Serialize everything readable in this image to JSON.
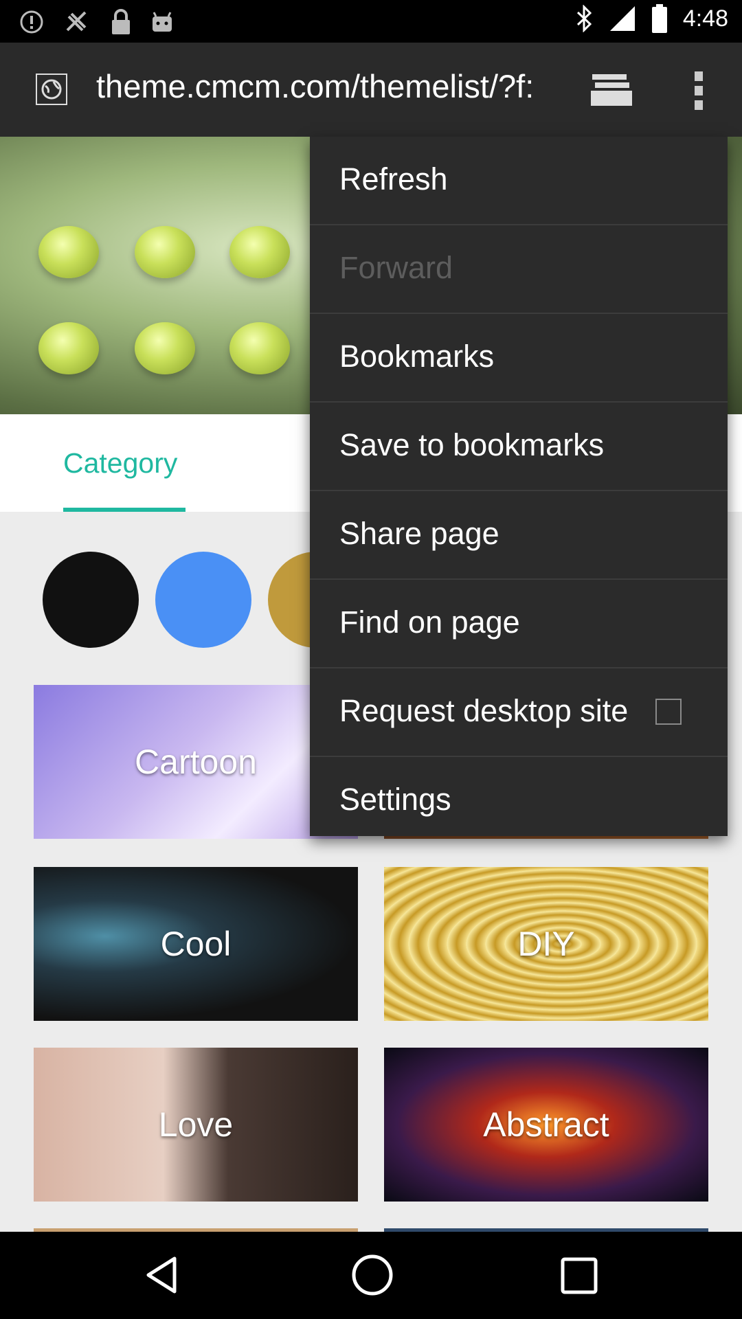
{
  "status_bar": {
    "time": "4:48",
    "icons": [
      "alert-icon",
      "fake-gps-icon",
      "lock-icon",
      "android-icon",
      "bluetooth-icon",
      "signal-icon",
      "battery-icon"
    ]
  },
  "toolbar": {
    "url": "theme.cmcm.com/themelist/?f:",
    "icons": [
      "site-icon",
      "tabs-icon",
      "more-vert-icon"
    ]
  },
  "page": {
    "tab_label": "Category",
    "accent_color": "#1fb8a0",
    "swatch_colors": [
      "#111111",
      "#4a90f5",
      "#c09a3c"
    ],
    "cards": [
      {
        "label": "Cartoon"
      },
      {
        "label": ""
      },
      {
        "label": "Cool"
      },
      {
        "label": "DIY"
      },
      {
        "label": "Love"
      },
      {
        "label": "Abstract"
      }
    ]
  },
  "menu": {
    "items": [
      {
        "label": "Refresh",
        "enabled": true
      },
      {
        "label": "Forward",
        "enabled": false
      },
      {
        "label": "Bookmarks",
        "enabled": true
      },
      {
        "label": "Save to bookmarks",
        "enabled": true
      },
      {
        "label": "Share page",
        "enabled": true
      },
      {
        "label": "Find on page",
        "enabled": true
      },
      {
        "label": "Request desktop site",
        "enabled": true,
        "checked": false
      },
      {
        "label": "Settings",
        "enabled": true
      }
    ]
  },
  "nav_bar": {
    "icons": [
      "back-icon",
      "home-icon",
      "recents-icon"
    ]
  }
}
